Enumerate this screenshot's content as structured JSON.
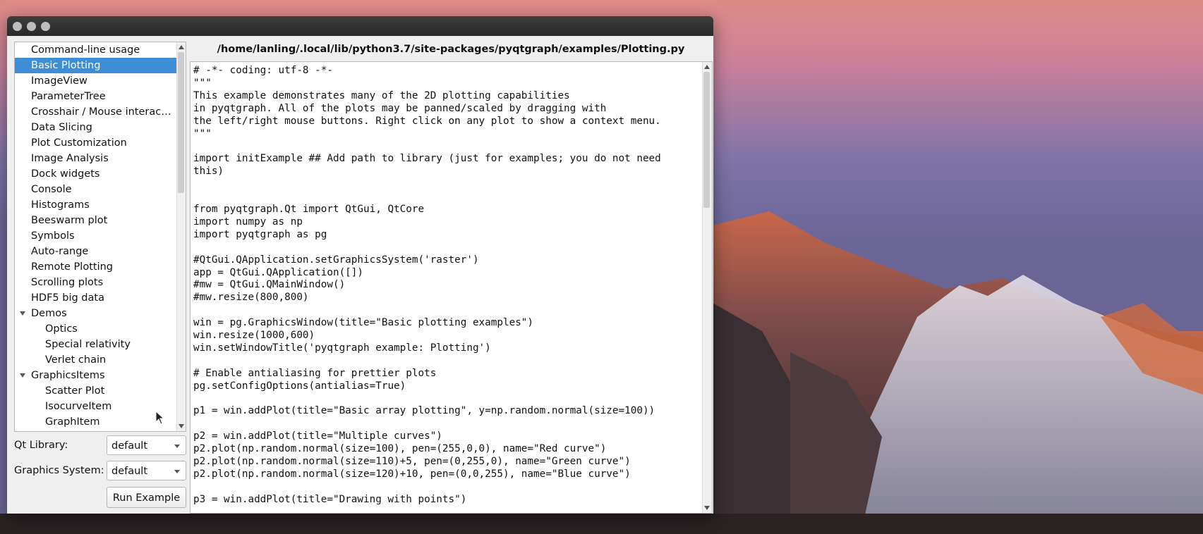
{
  "window": {
    "title_buttons": [
      "close",
      "minimize",
      "maximize"
    ]
  },
  "tree": {
    "items": [
      {
        "label": "Command-line usage",
        "level": 0
      },
      {
        "label": "Basic Plotting",
        "level": 0,
        "selected": true
      },
      {
        "label": "ImageView",
        "level": 0
      },
      {
        "label": "ParameterTree",
        "level": 0
      },
      {
        "label": "Crosshair / Mouse interac…",
        "level": 0
      },
      {
        "label": "Data Slicing",
        "level": 0
      },
      {
        "label": "Plot Customization",
        "level": 0
      },
      {
        "label": "Image Analysis",
        "level": 0
      },
      {
        "label": "Dock widgets",
        "level": 0
      },
      {
        "label": "Console",
        "level": 0
      },
      {
        "label": "Histograms",
        "level": 0
      },
      {
        "label": "Beeswarm plot",
        "level": 0
      },
      {
        "label": "Symbols",
        "level": 0
      },
      {
        "label": "Auto-range",
        "level": 0
      },
      {
        "label": "Remote Plotting",
        "level": 0
      },
      {
        "label": "Scrolling plots",
        "level": 0
      },
      {
        "label": "HDF5 big data",
        "level": 0
      },
      {
        "label": "Demos",
        "level": 0,
        "expanded": true
      },
      {
        "label": "Optics",
        "level": 1
      },
      {
        "label": "Special relativity",
        "level": 1
      },
      {
        "label": "Verlet chain",
        "level": 1
      },
      {
        "label": "GraphicsItems",
        "level": 0,
        "expanded": true
      },
      {
        "label": "Scatter Plot",
        "level": 1
      },
      {
        "label": "IsocurveItem",
        "level": 1
      },
      {
        "label": "GraphItem",
        "level": 1
      }
    ]
  },
  "controls": {
    "qt_library_label": "Qt Library:",
    "qt_library_value": "default",
    "graphics_system_label": "Graphics System:",
    "graphics_system_value": "default",
    "run_button": "Run Example"
  },
  "editor": {
    "file_path": "/home/lanling/.local/lib/python3.7/site-packages/pyqtgraph/examples/Plotting.py",
    "code": "# -*- coding: utf-8 -*-\n\"\"\"\nThis example demonstrates many of the 2D plotting capabilities\nin pyqtgraph. All of the plots may be panned/scaled by dragging with\nthe left/right mouse buttons. Right click on any plot to show a context menu.\n\"\"\"\n\nimport initExample ## Add path to library (just for examples; you do not need\nthis)\n\n\nfrom pyqtgraph.Qt import QtGui, QtCore\nimport numpy as np\nimport pyqtgraph as pg\n\n#QtGui.QApplication.setGraphicsSystem('raster')\napp = QtGui.QApplication([])\n#mw = QtGui.QMainWindow()\n#mw.resize(800,800)\n\nwin = pg.GraphicsWindow(title=\"Basic plotting examples\")\nwin.resize(1000,600)\nwin.setWindowTitle('pyqtgraph example: Plotting')\n\n# Enable antialiasing for prettier plots\npg.setConfigOptions(antialias=True)\n\np1 = win.addPlot(title=\"Basic array plotting\", y=np.random.normal(size=100))\n\np2 = win.addPlot(title=\"Multiple curves\")\np2.plot(np.random.normal(size=100), pen=(255,0,0), name=\"Red curve\")\np2.plot(np.random.normal(size=110)+5, pen=(0,255,0), name=\"Green curve\")\np2.plot(np.random.normal(size=120)+10, pen=(0,0,255), name=\"Blue curve\")\n\np3 = win.addPlot(title=\"Drawing with points\")"
  },
  "colors": {
    "selection": "#3d8ed6",
    "titlebar": "#2f2f2f"
  }
}
